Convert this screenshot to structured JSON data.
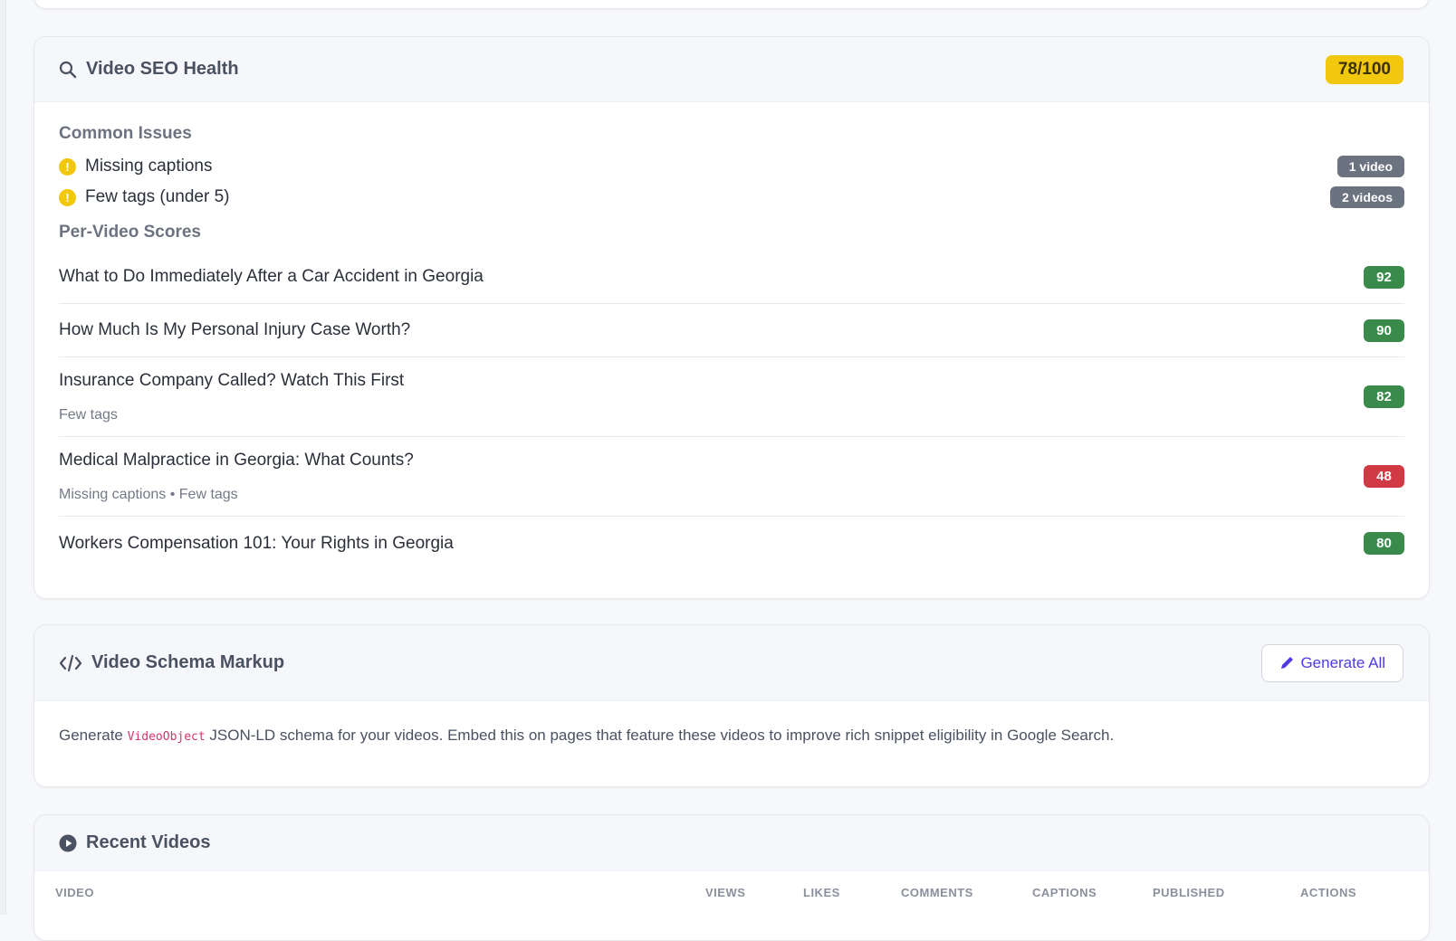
{
  "colors": {
    "score_yellow": "#f2c80f",
    "score_green": "#3a8a4b",
    "score_red": "#d13a45",
    "badge_gray": "#6b7280",
    "accent_purple": "#4d3ae0"
  },
  "seo": {
    "title": "Video SEO Health",
    "icon": "search-icon",
    "score": "78/100",
    "common_issues_title": "Common Issues",
    "issues": [
      {
        "label": "Missing captions",
        "count": "1 video"
      },
      {
        "label": "Few tags (under 5)",
        "count": "2 videos"
      }
    ],
    "per_video_title": "Per-Video Scores",
    "videos": [
      {
        "title": "What to Do Immediately After a Car Accident in Georgia",
        "sub": "",
        "score": "92",
        "status": "good"
      },
      {
        "title": "How Much Is My Personal Injury Case Worth?",
        "sub": "",
        "score": "90",
        "status": "good"
      },
      {
        "title": "Insurance Company Called? Watch This First",
        "sub": "Few tags",
        "score": "82",
        "status": "good"
      },
      {
        "title": "Medical Malpractice in Georgia: What Counts?",
        "sub": "Missing captions • Few tags",
        "score": "48",
        "status": "bad"
      },
      {
        "title": "Workers Compensation 101: Your Rights in Georgia",
        "sub": "",
        "score": "80",
        "status": "good"
      }
    ]
  },
  "schema": {
    "title": "Video Schema Markup",
    "icon": "code-icon",
    "button_label": "Generate All",
    "button_icon": "pencil-icon",
    "desc_before": "Generate ",
    "desc_code": "VideoObject",
    "desc_after": " JSON-LD schema for your videos. Embed this on pages that feature these videos to improve rich snippet eligibility in Google Search."
  },
  "recent": {
    "title": "Recent Videos",
    "icon": "play-circle-icon",
    "columns": [
      "VIDEO",
      "VIEWS",
      "LIKES",
      "COMMENTS",
      "CAPTIONS",
      "PUBLISHED",
      "ACTIONS"
    ]
  }
}
